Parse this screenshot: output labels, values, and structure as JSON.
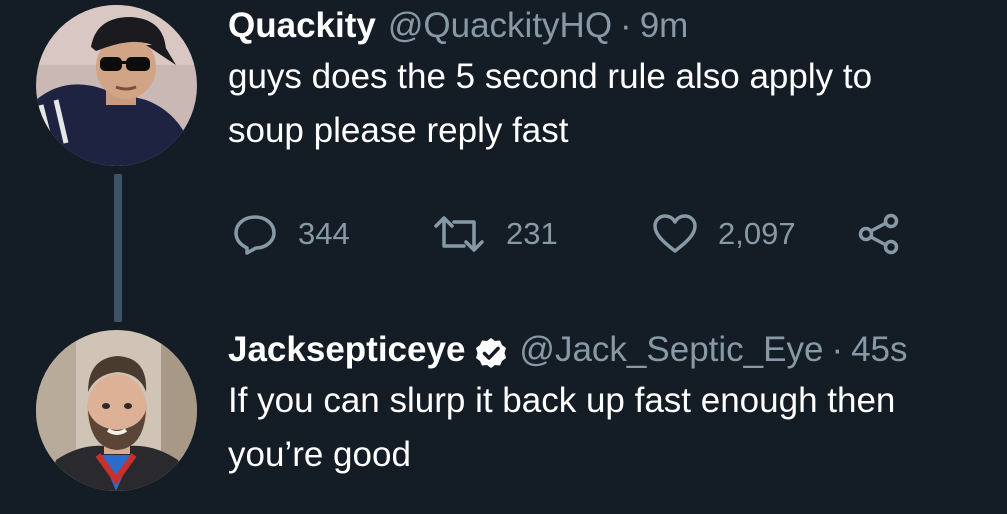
{
  "tweets": [
    {
      "display_name": "Quackity",
      "handle": "@QuackityHQ",
      "separator": "·",
      "time": "9m",
      "text_line1": "guys does the 5 second rule also apply to",
      "text_line2": "soup please reply fast",
      "avatar_icon": "user-avatar",
      "stats": {
        "replies": "344",
        "retweets": "231",
        "likes": "2,097"
      }
    },
    {
      "display_name": "Jacksepticeye",
      "verified": true,
      "verified_icon": "verified-badge-icon",
      "handle": "@Jack_Septic_Eye",
      "separator": "·",
      "time": "45s",
      "text_line1": "If you can slurp it back up fast enough then",
      "text_line2": "you’re good",
      "avatar_icon": "user-avatar"
    }
  ],
  "colors": {
    "background": "#141d26",
    "primary_text": "#ffffff",
    "secondary_text": "#8899a6",
    "thread_line": "#3d5466"
  },
  "icons": [
    "reply-icon",
    "retweet-icon",
    "like-icon",
    "share-icon"
  ]
}
